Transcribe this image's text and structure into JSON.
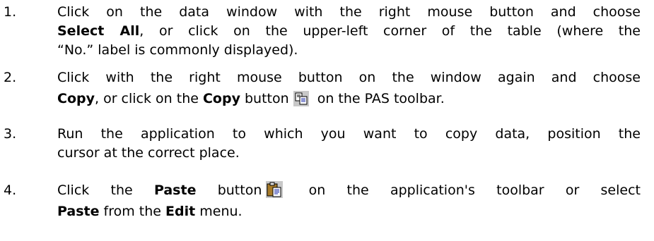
{
  "steps": [
    {
      "number": "1.",
      "lines": [
        {
          "parts": [
            "Click on the data window with the right mouse button and choose"
          ]
        },
        {
          "parts": [
            "Select All",
            ", or click on the upper-left corner of the table (where the"
          ]
        },
        {
          "parts": [
            "“No.” label is commonly displayed)."
          ]
        }
      ]
    },
    {
      "number": "2.",
      "lines": [
        {
          "parts": [
            "Click with the right mouse button on the window again and choose"
          ]
        },
        {
          "parts": [
            "Copy",
            ", or click on the ",
            "Copy",
            " button",
            " on the PAS toolbar."
          ]
        }
      ]
    },
    {
      "number": "3.",
      "lines": [
        {
          "parts": [
            "Run the application to which you want to copy data, position the"
          ]
        },
        {
          "parts": [
            "cursor at the correct place."
          ]
        }
      ]
    },
    {
      "number": "4.",
      "lines": [
        {
          "parts": [
            "Click the ",
            "Paste",
            " button",
            " on the application's toolbar or select"
          ]
        },
        {
          "parts": [
            "Paste",
            " from the ",
            "Edit",
            " menu."
          ]
        }
      ]
    }
  ],
  "icons": {
    "copy": "copy-icon",
    "paste": "paste-icon"
  }
}
